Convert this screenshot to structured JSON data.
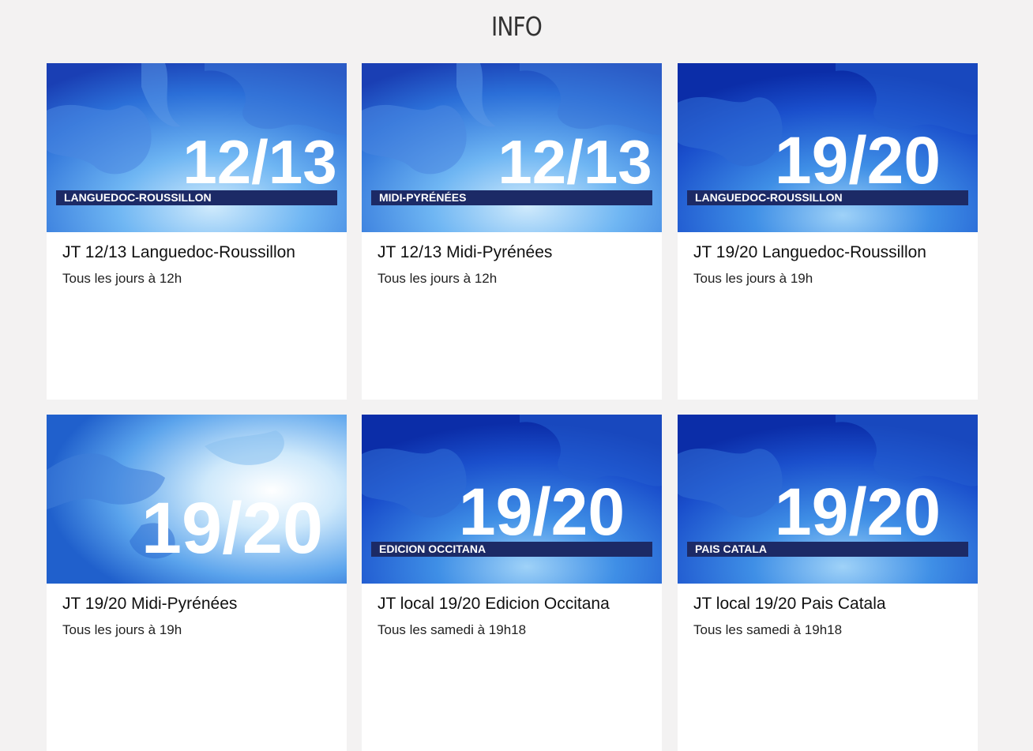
{
  "page": {
    "title": "INFO"
  },
  "cards": [
    {
      "image_number": "12/13",
      "image_region": "LANGUEDOC-ROUSSILLON",
      "title": "JT 12/13 Languedoc-Roussillon",
      "schedule": "Tous les jours à 12h"
    },
    {
      "image_number": "12/13",
      "image_region": "MIDI-PYRÉNÉES",
      "title": "JT 12/13 Midi-Pyrénées",
      "schedule": "Tous les jours à 12h"
    },
    {
      "image_number": "19/20",
      "image_region": "LANGUEDOC-ROUSSILLON",
      "title": "JT 19/20 Languedoc-Roussillon",
      "schedule": "Tous les jours à 19h"
    },
    {
      "image_number": "19/20",
      "image_region": "",
      "title": "JT 19/20 Midi-Pyrénées",
      "schedule": "Tous les jours à 19h"
    },
    {
      "image_number": "19/20",
      "image_region": "EDICION OCCITANA",
      "title": "JT local 19/20 Edicion Occitana",
      "schedule": "Tous les samedi à 19h18"
    },
    {
      "image_number": "19/20",
      "image_region": "PAIS CATALA",
      "title": "JT local 19/20 Pais Catala",
      "schedule": "Tous les samedi à 19h18"
    }
  ],
  "colors": {
    "background": "#f3f2f2",
    "card": "#ffffff",
    "thumb_blue_dark": "#0a3fb8",
    "thumb_blue_light": "#7fc3f5",
    "band": "#1c2a66"
  }
}
